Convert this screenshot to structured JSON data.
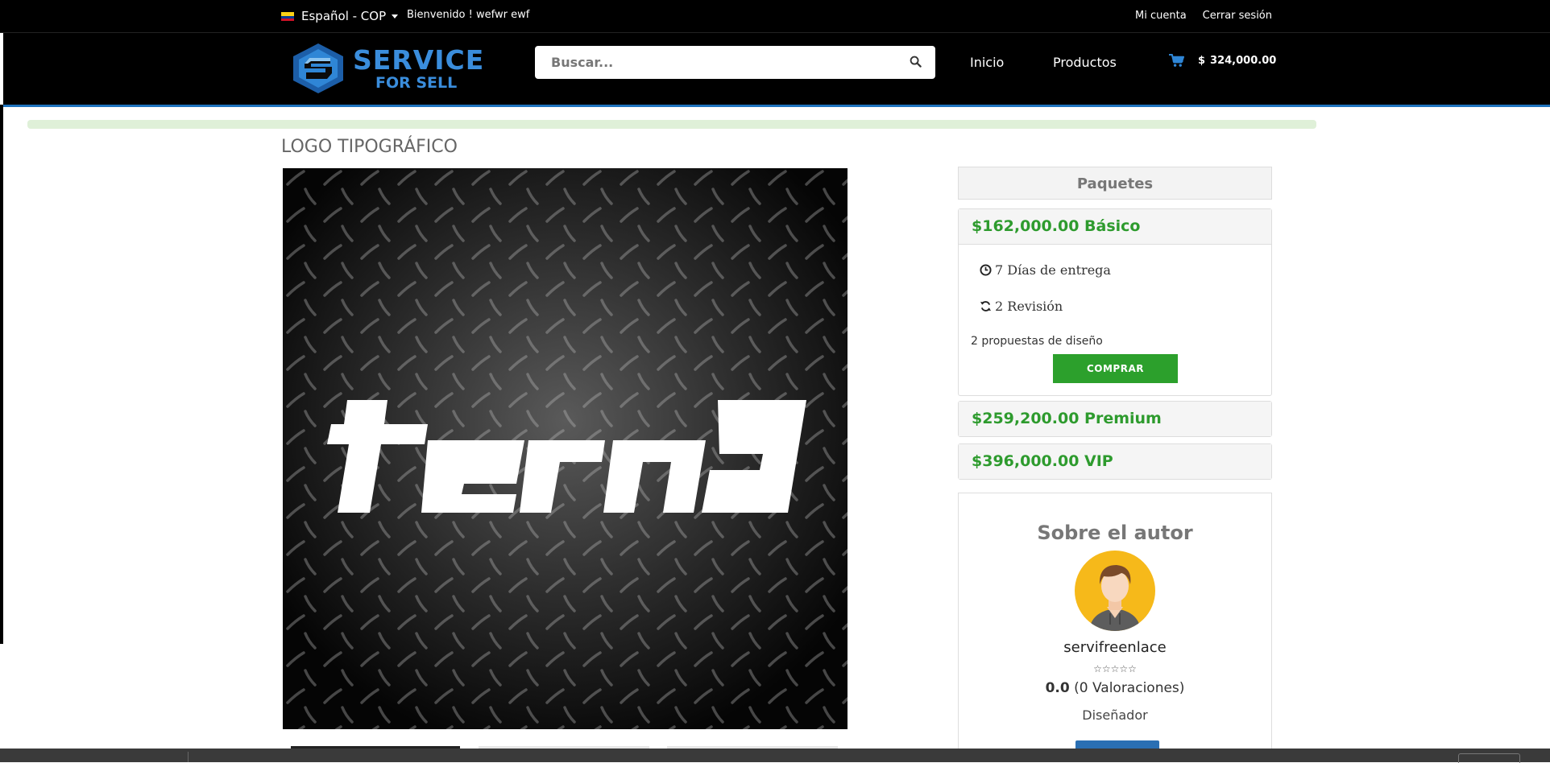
{
  "topbar": {
    "language": "Español - COP",
    "welcome": "Bienvenido ! wefwr ewf",
    "links": {
      "account": "Mi cuenta",
      "logout": "Cerrar sesión"
    }
  },
  "header": {
    "logo_line1": "SERVICE",
    "logo_line2": "FOR SELL",
    "search_placeholder": "Buscar...",
    "nav": {
      "home": "Inicio",
      "products": "Productos"
    },
    "cart": {
      "symbol": "$",
      "total": "324,000.00"
    }
  },
  "product": {
    "title": "LOGO TIPOGRÁFICO",
    "image_word": "terna"
  },
  "packages": {
    "heading": "Paquetes",
    "items": [
      {
        "title": "$162,000.00 Básico",
        "delivery": "7 Días de entrega",
        "revisions": "2 Revisión",
        "description": "2 propuestas de diseño",
        "buy_label": "COMPRAR"
      },
      {
        "title": "$259,200.00 Premium"
      },
      {
        "title": "$396,000.00 VIP"
      }
    ]
  },
  "author": {
    "heading": "Sobre el autor",
    "username": "servifreenlace",
    "stars": "☆☆☆☆☆",
    "score": "0.0",
    "ratings": "(0 Valoraciones)",
    "role": "Diseñador"
  },
  "colors": {
    "price_green": "#2e9b2e",
    "buy_button": "#2ca02c",
    "brand_blue": "#3a8ddc",
    "header_bg": "#000000"
  }
}
